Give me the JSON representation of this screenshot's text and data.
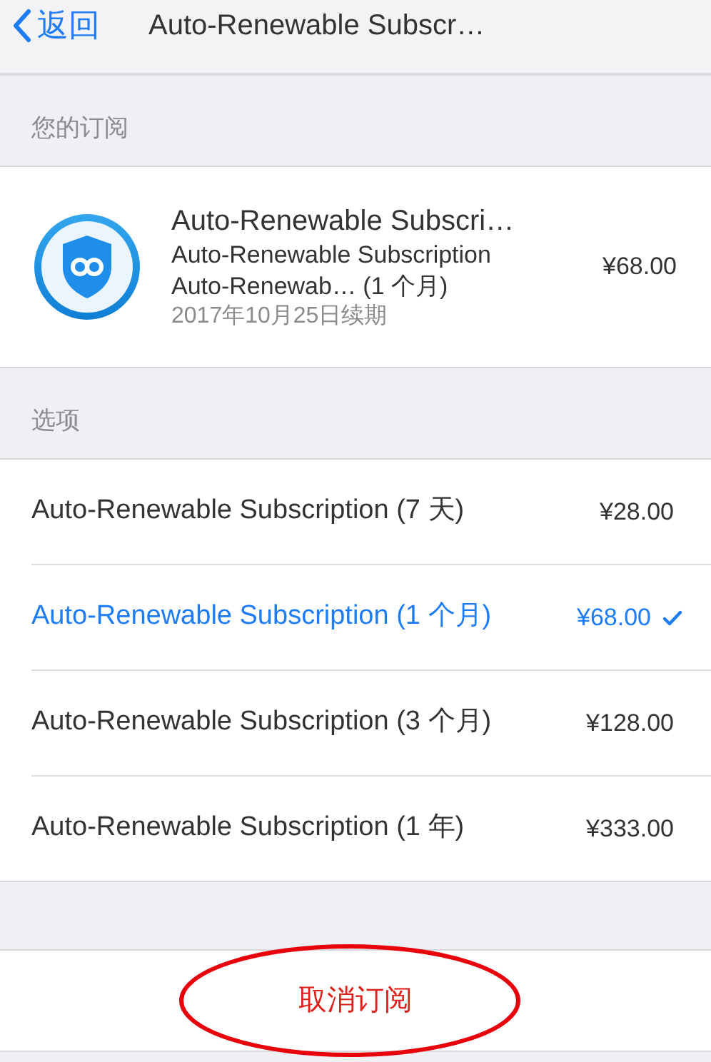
{
  "nav": {
    "back_label": "返回",
    "title": "Auto-Renewable Subscr…"
  },
  "subscription_section": {
    "header": "您的订阅",
    "item": {
      "title": "Auto-Renewable Subscri…",
      "subtitle": "Auto-Renewable Subscription",
      "plan": "Auto-Renewab…  (1 个月)",
      "renewal": "2017年10月25日续期",
      "price": "¥68.00"
    }
  },
  "options_section": {
    "header": "选项",
    "options": [
      {
        "label": "Auto-Renewable Subscription (7 天)",
        "price": "¥28.00",
        "selected": false
      },
      {
        "label": "Auto-Renewable Subscription (1 个月)",
        "price": "¥68.00",
        "selected": true
      },
      {
        "label": "Auto-Renewable Subscription (3 个月)",
        "price": "¥128.00",
        "selected": false
      },
      {
        "label": "Auto-Renewable Subscription (1 年)",
        "price": "¥333.00",
        "selected": false
      }
    ]
  },
  "cancel_button": {
    "label": "取消订阅"
  }
}
